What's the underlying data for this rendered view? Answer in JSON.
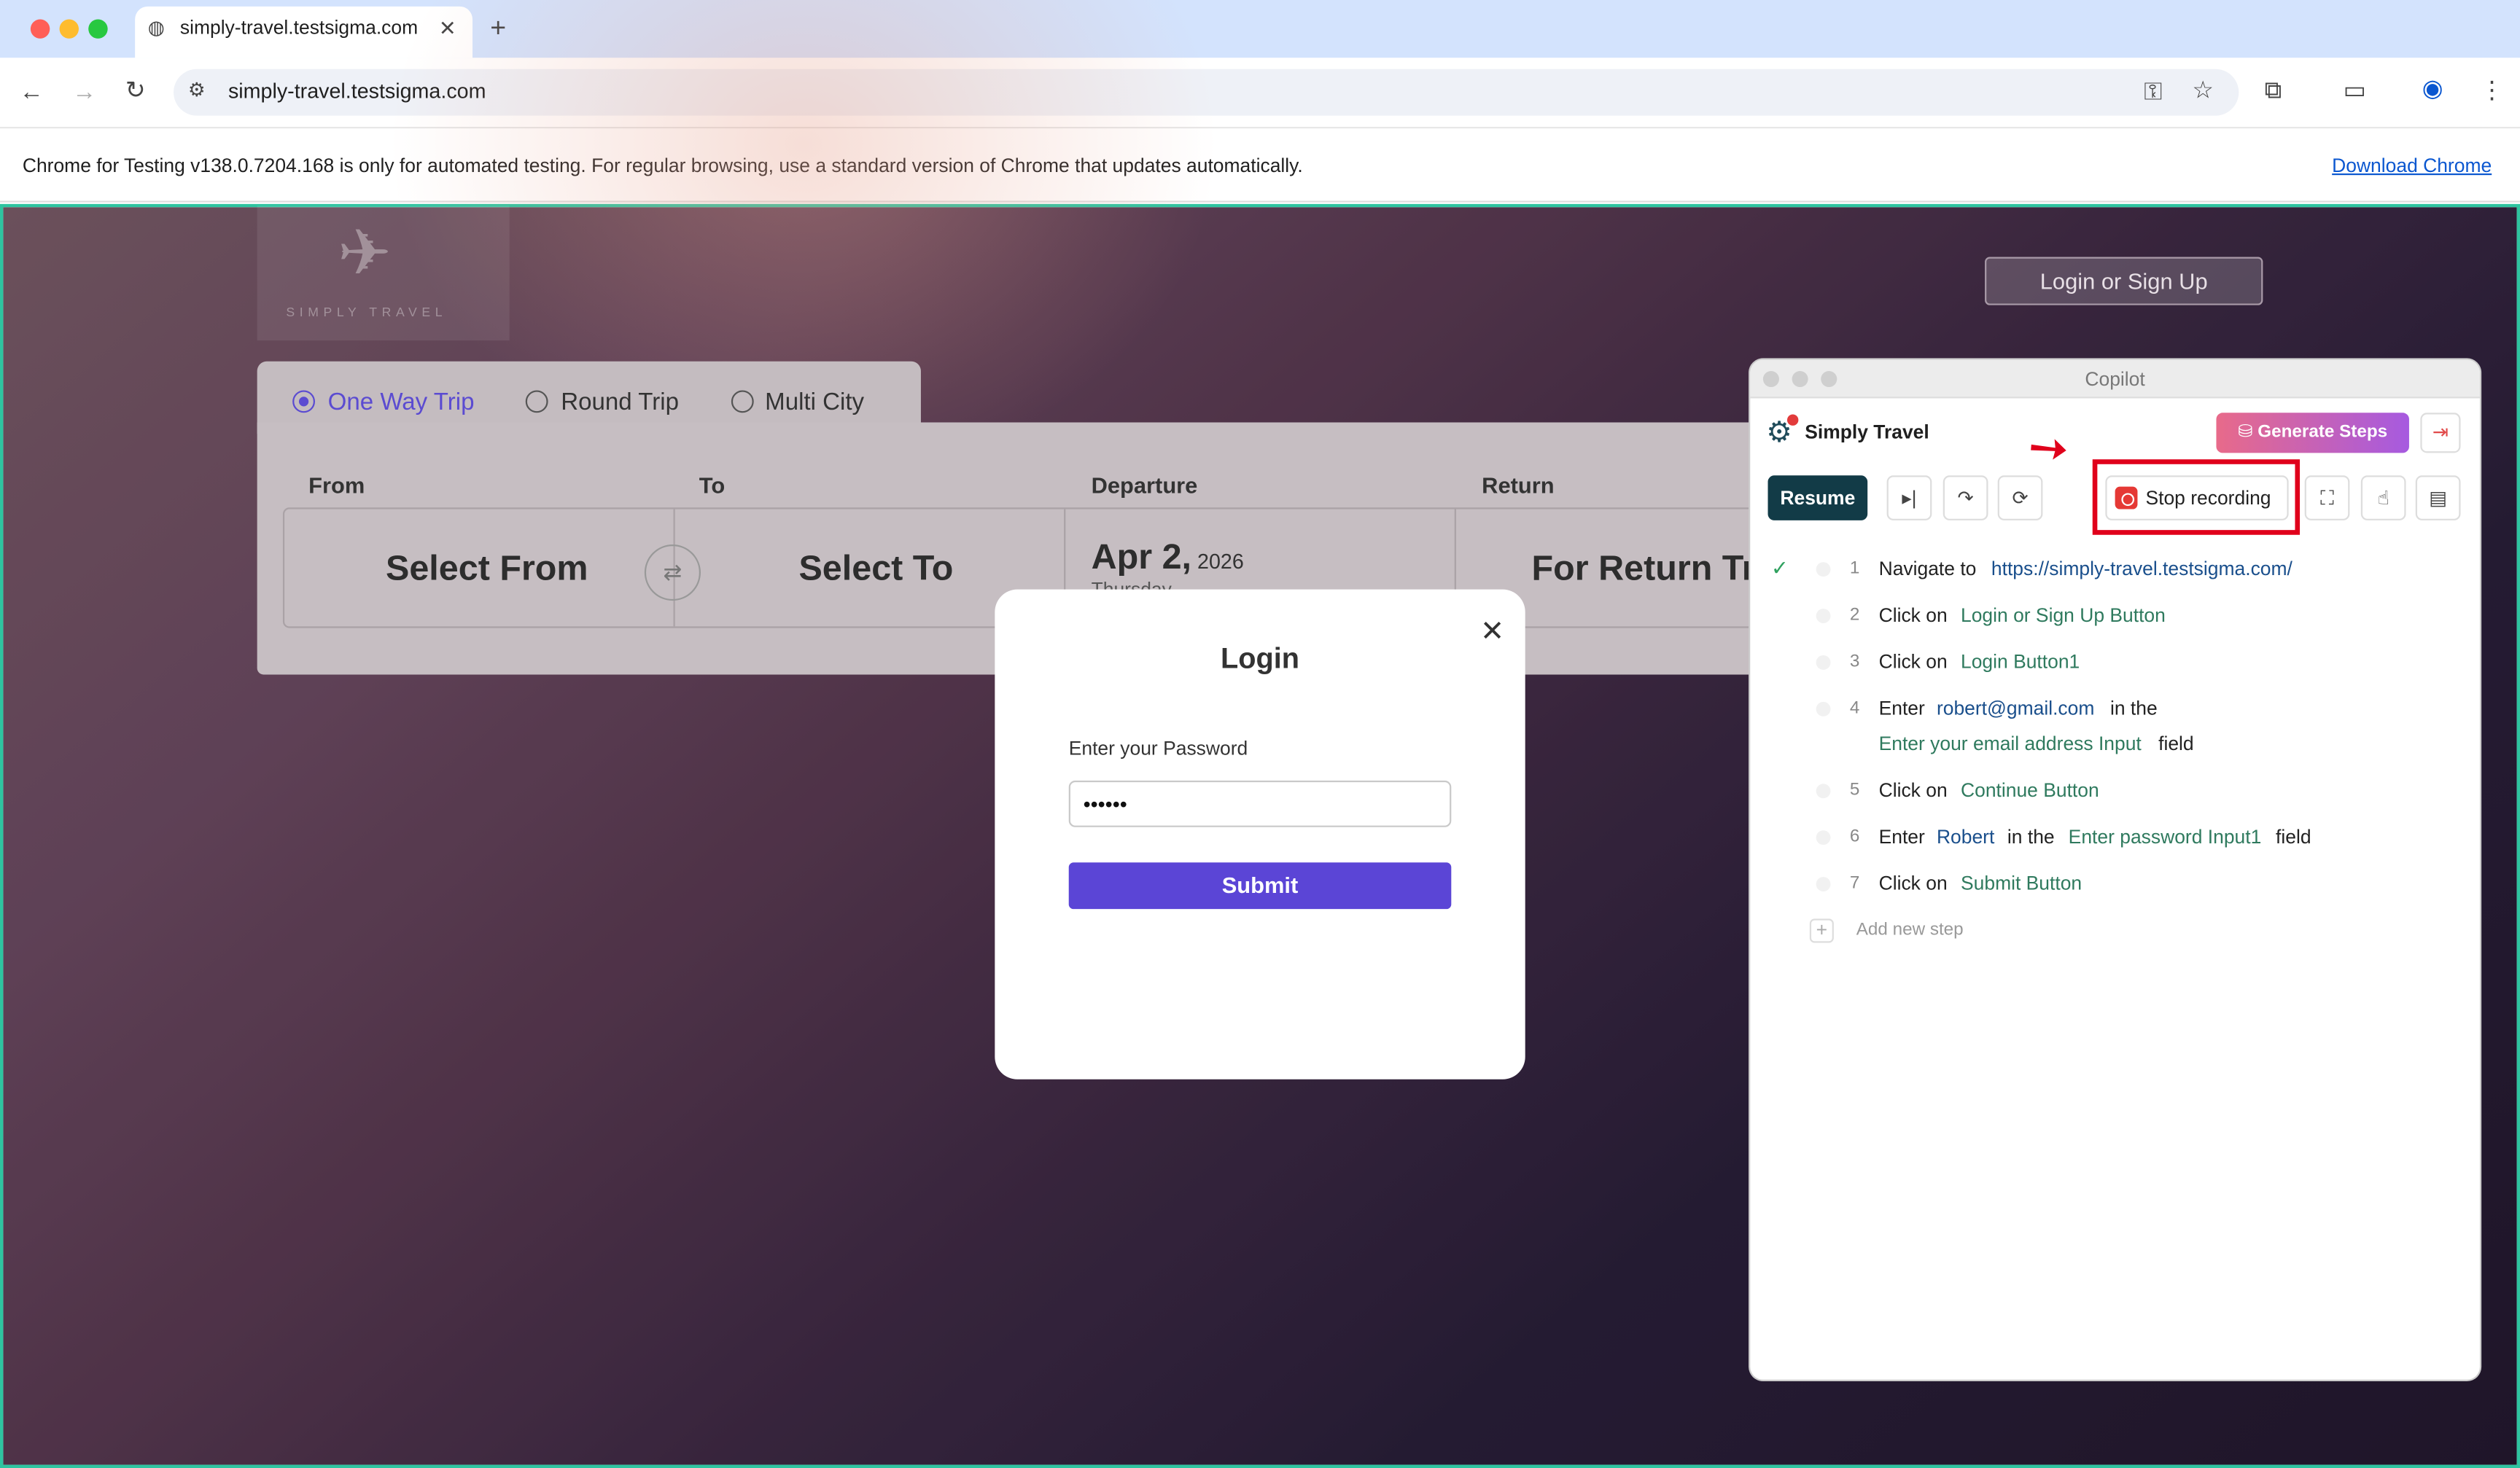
{
  "browser": {
    "tab_title": "simply-travel.testsigma.com",
    "url": "simply-travel.testsigma.com",
    "new_tab_icon": "plus-icon",
    "infobar_text": "Chrome for Testing v138.0.7204.168 is only for automated testing. For regular browsing, use a standard version of Chrome that updates automatically.",
    "infobar_link": "Download Chrome"
  },
  "site": {
    "logo_text": "SIMPLY TRAVEL",
    "login_button": "Login or Sign Up",
    "trip_types": [
      "One Way Trip",
      "Round Trip",
      "Multi City"
    ],
    "selected_trip": "One Way Trip",
    "fields": {
      "from_label": "From",
      "to_label": "To",
      "departure_label": "Departure",
      "return_label": "Return",
      "from_value": "Select From",
      "to_value": "Select To",
      "departure_date": "Apr 2,",
      "departure_year": "2026",
      "departure_day": "Thursday",
      "return_value": "For Return Trip"
    }
  },
  "modal": {
    "title": "Login",
    "label": "Enter your Password",
    "password_value": "••••••",
    "submit": "Submit",
    "close_icon": "close-icon"
  },
  "copilot": {
    "window_title": "Copilot",
    "brand": "Simply Travel",
    "generate": "Generate Steps",
    "resume": "Resume",
    "stop_recording": "Stop recording",
    "add_step": "Add new step",
    "steps": [
      {
        "n": "1",
        "a": "Navigate to",
        "v": "https://simply-travel.testsigma.com/"
      },
      {
        "n": "2",
        "a": "Click on",
        "e": "Login or Sign Up Button"
      },
      {
        "n": "3",
        "a": "Click on",
        "e": "Login Button1"
      },
      {
        "n": "4",
        "a": "Enter",
        "v": "robert@gmail.com",
        "m": "in the",
        "e": "Enter your email address Input",
        "f": "field"
      },
      {
        "n": "5",
        "a": "Click on",
        "e": "Continue Button"
      },
      {
        "n": "6",
        "a": "Enter",
        "v": "Robert",
        "m": "in the",
        "e": "Enter password Input1",
        "f": "field"
      },
      {
        "n": "7",
        "a": "Click on",
        "e": "Submit Button"
      }
    ]
  },
  "colors": {
    "accent": "#5b45d6",
    "copilot_dark": "#123b47",
    "highlight": "#e0001b"
  }
}
